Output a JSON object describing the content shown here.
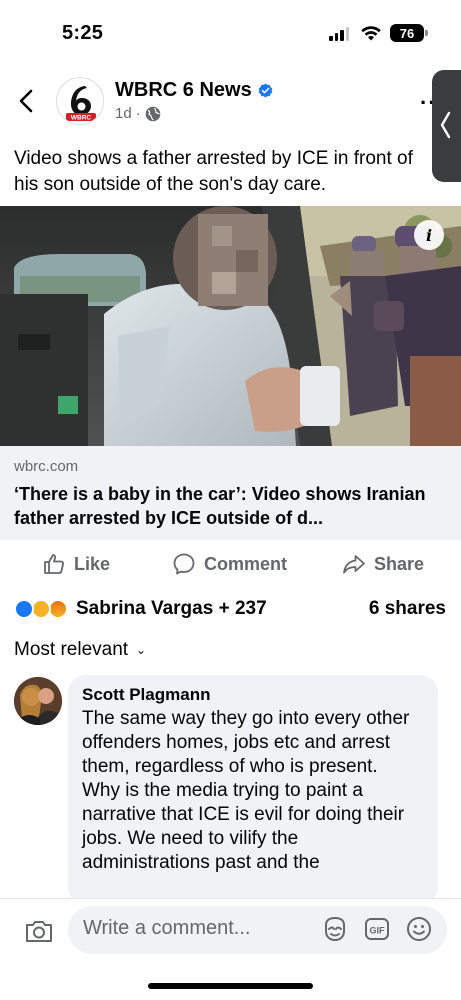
{
  "status_bar": {
    "time": "5:25",
    "battery": "76"
  },
  "post": {
    "page_name": "WBRC 6 News",
    "time_ago": "1d",
    "separator": "·",
    "text": "Video shows a father arrested by ICE in front of his son outside of the son's day care."
  },
  "link_preview": {
    "domain": "wbrc.com",
    "title": "‘There is a baby in the car’: Video shows Iranian father arrested by ICE outside of d..."
  },
  "actions": {
    "like": "Like",
    "comment": "Comment",
    "share": "Share"
  },
  "engagement": {
    "reactors": "Sabrina Vargas + 237",
    "shares": "6 shares"
  },
  "comments_sort": {
    "label": "Most relevant"
  },
  "comment": {
    "author": "Scott Plagmann",
    "text": "The same way they go into every other offenders homes, jobs etc and arrest them, regardless of who is present.\nWhy is the media trying to paint a narrative that ICE is evil for doing their jobs. We need to vilify the administrations past and the"
  },
  "composer": {
    "placeholder": "Write a comment..."
  },
  "colors": {
    "facebook_blue": "#1877f2",
    "secondary_text": "#65676b",
    "bubble_bg": "#f0f2f5",
    "brand_red": "#d41f26"
  },
  "icons": [
    "back-chevron-icon",
    "verified-badge-icon",
    "globe-icon",
    "more-icon",
    "info-icon",
    "like-icon",
    "comment-icon",
    "share-icon",
    "camera-icon",
    "avatar-sticker-icon",
    "gif-icon",
    "emoji-icon"
  ]
}
